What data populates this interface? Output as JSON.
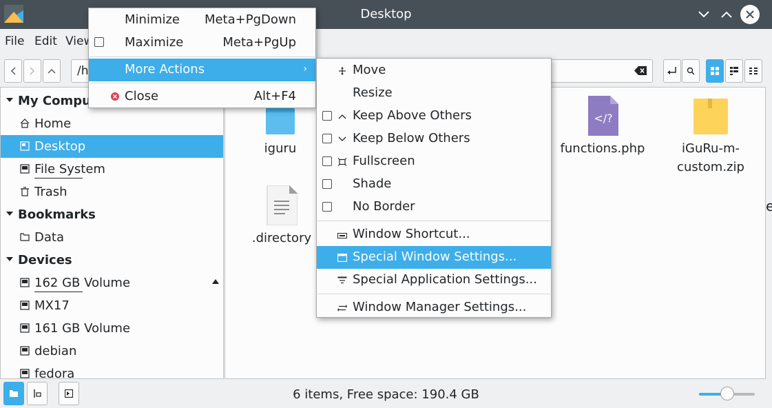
{
  "window": {
    "title": "Desktop",
    "edge_text": "e"
  },
  "menubar": {
    "items": [
      "File",
      "Edit",
      "View"
    ]
  },
  "toolbar": {
    "location": "/h"
  },
  "sidebar": {
    "sections": [
      {
        "label": "My Computer",
        "items": [
          "Home",
          "Desktop",
          "File System",
          "Trash"
        ]
      },
      {
        "label": "Bookmarks",
        "items": [
          "Data"
        ]
      },
      {
        "label": "Devices",
        "items": [
          "162 GB Volume",
          "MX17",
          "161 GB Volume",
          "debian",
          "fedora"
        ]
      }
    ],
    "selected": "Desktop"
  },
  "files": [
    {
      "name": "iguru",
      "type": "folder"
    },
    {
      "name": "functions.php",
      "type": "php"
    },
    {
      "name": "iGuRu-m-custom.zip",
      "line1": "iGuRu-m-",
      "line2": "custom.zip",
      "type": "zip"
    },
    {
      "name": ".directory",
      "type": "text"
    }
  ],
  "status": {
    "text": "6 items, Free space: 190.4 GB",
    "zoom_level": 0.5
  },
  "context_menu": {
    "items": [
      {
        "label": "Minimize",
        "shortcut": "Meta+PgDown"
      },
      {
        "label": "Maximize",
        "shortcut": "Meta+PgUp"
      },
      {
        "label": "More Actions"
      },
      {
        "label": "Close",
        "shortcut": "Alt+F4"
      }
    ]
  },
  "submenu": {
    "items": [
      "Move",
      "Resize",
      "Keep Above Others",
      "Keep Below Others",
      "Fullscreen",
      "Shade",
      "No Border",
      "Window Shortcut...",
      "Special Window Settings...",
      "Special Application Settings...",
      "Window Manager Settings..."
    ]
  },
  "colors": {
    "accent": "#3daee9",
    "titlebar": "#475057",
    "folder": "#3daee9",
    "php": "#8e7cc3",
    "zip": "#fdd35a",
    "close_icon": "#da4453"
  }
}
